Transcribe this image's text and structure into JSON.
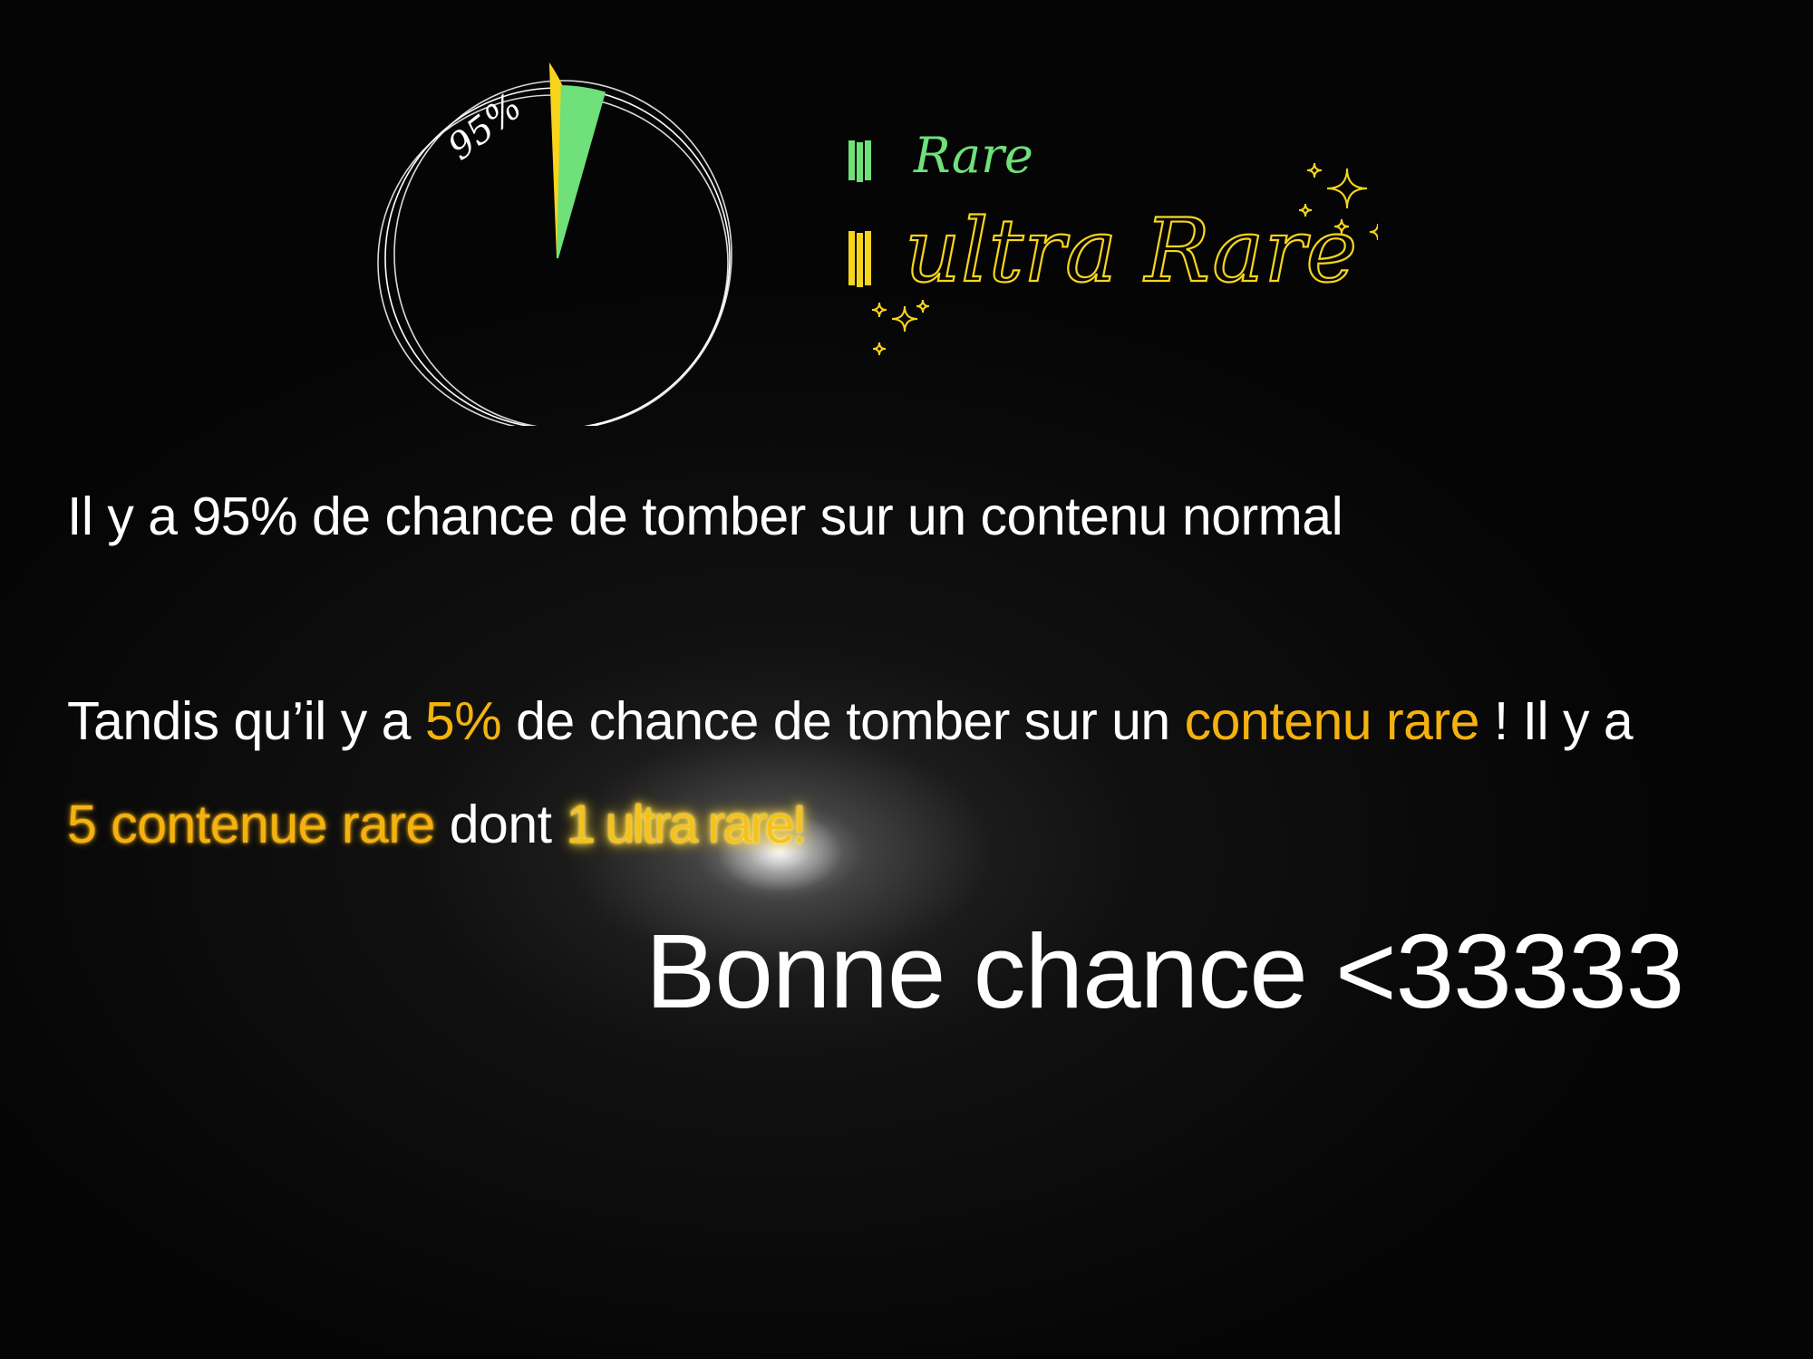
{
  "chart_data": {
    "type": "pie",
    "slices": [
      {
        "label": "normal",
        "value": 95
      },
      {
        "label": "Rare",
        "value": 4
      },
      {
        "label": "ultra Rare",
        "value": 1
      }
    ],
    "annotation": "95%",
    "legend": [
      {
        "label": "Rare",
        "color": "#6fe07a"
      },
      {
        "label": "ultra Rare",
        "color": "#f7d51d"
      }
    ],
    "legend_position": "right"
  },
  "colors": {
    "rare": "#6fe07a",
    "ultra_rare": "#f7d51d",
    "highlight": "#f5b20f",
    "outline": "#ffffff",
    "background": "#050505"
  },
  "text": {
    "line1": "Il y a 95% de chance de tomber sur un contenu normal",
    "line2": {
      "part1": "Tandis qu’il y a ",
      "pct": "5%",
      "part2": " de chance de tomber sur un ",
      "rare": "contenu rare",
      "part3": " ! Il y a"
    },
    "line3": {
      "count": "5 contenue rare",
      "dont": " dont ",
      "ultra": "1 ultra rare!"
    },
    "closing": "Bonne chance <33333"
  }
}
